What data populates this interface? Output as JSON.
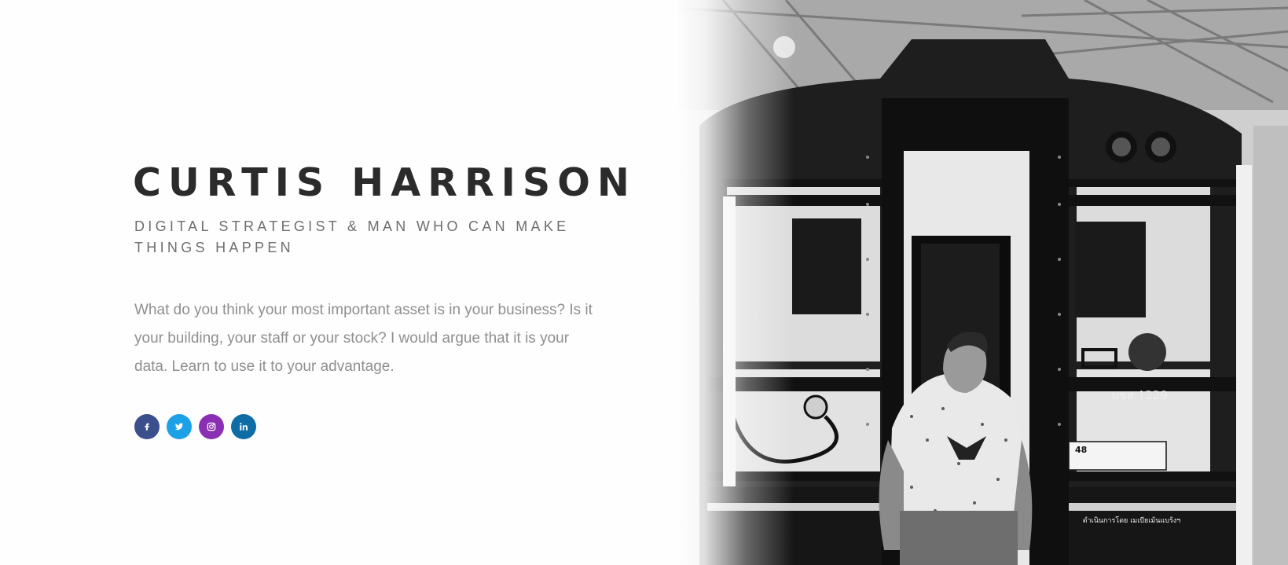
{
  "hero": {
    "name": "CURTIS HARRISON",
    "tagline": "DIGITAL STRATEGIST & MAN WHO CAN MAKE THINGS HAPPEN",
    "intro": "What do you think your most important asset is in your business? Is it your building, your staff or your stock? I would argue that it is your data. Learn to use it to your advantage."
  },
  "social": [
    {
      "name": "facebook",
      "icon": "facebook-icon",
      "color": "#3b4f8c"
    },
    {
      "name": "twitter",
      "icon": "twitter-icon",
      "color": "#1da1e6"
    },
    {
      "name": "instagram",
      "icon": "instagram-icon",
      "color": "#8a2fb3"
    },
    {
      "name": "linkedin",
      "icon": "linkedin-icon",
      "color": "#0e6da5"
    }
  ],
  "photo": {
    "subject": "man seated on train platform-step, black and white",
    "train_number": "บชส.1229",
    "plate_number": "48",
    "panel_text": "ดำเนินการโดย เมเบียเม้นแบร้งฯ"
  }
}
